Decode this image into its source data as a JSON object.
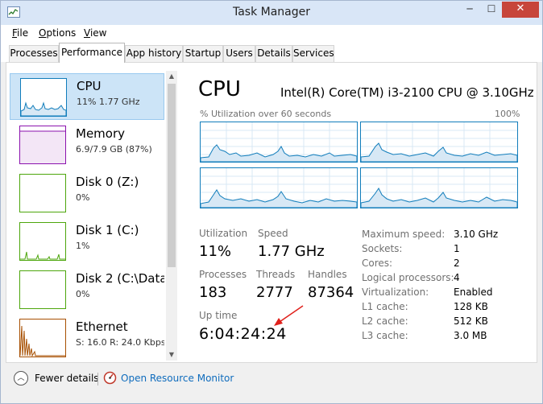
{
  "window": {
    "title": "Task Manager",
    "minimize_glyph": "─",
    "maximize_glyph": "☐",
    "close_glyph": "✕",
    "icon": "task-manager-icon"
  },
  "menu": [
    {
      "label": "File",
      "key": "F"
    },
    {
      "label": "Options",
      "key": "O"
    },
    {
      "label": "View",
      "key": "V"
    }
  ],
  "tabs": [
    {
      "label": "Processes",
      "active": false
    },
    {
      "label": "Performance",
      "active": true
    },
    {
      "label": "App history",
      "active": false
    },
    {
      "label": "Startup",
      "active": false
    },
    {
      "label": "Users",
      "active": false
    },
    {
      "label": "Details",
      "active": false
    },
    {
      "label": "Services",
      "active": false
    }
  ],
  "sidebar": {
    "items": [
      {
        "title": "CPU",
        "subtitle": "11% 1.77 GHz",
        "selected": true,
        "color": "#117dbb"
      },
      {
        "title": "Memory",
        "subtitle": "6.9/7.9 GB (87%)",
        "selected": false,
        "color": "#8b12ae"
      },
      {
        "title": "Disk 0 (Z:)",
        "subtitle": "0%",
        "selected": false,
        "color": "#4da60c"
      },
      {
        "title": "Disk 1 (C:)",
        "subtitle": "1%",
        "selected": false,
        "color": "#4da60c"
      },
      {
        "title": "Disk 2 (C:\\Data\\",
        "subtitle": "0%",
        "selected": false,
        "color": "#4da60c"
      },
      {
        "title": "Ethernet",
        "subtitle": "S: 16.0  R: 24.0 Kbps",
        "selected": false,
        "color": "#a74f01"
      }
    ],
    "scroll_up_glyph": "▲",
    "scroll_down_glyph": "▼"
  },
  "detail": {
    "title": "CPU",
    "model": "Intel(R) Core(TM) i3-2100 CPU @ 3.10GHz",
    "graph_caption": "% Utilization over 60 seconds",
    "graph_max": "100%",
    "graph_color": "#117dbb"
  },
  "stats": {
    "utilization": {
      "label": "Utilization",
      "value": "11%"
    },
    "speed": {
      "label": "Speed",
      "value": "1.77 GHz"
    },
    "processes": {
      "label": "Processes",
      "value": "183"
    },
    "threads": {
      "label": "Threads",
      "value": "2777"
    },
    "handles": {
      "label": "Handles",
      "value": "87364"
    },
    "uptime": {
      "label": "Up time",
      "value": "6:04:24:24"
    }
  },
  "specs": [
    {
      "label": "Maximum speed:",
      "value": "3.10 GHz"
    },
    {
      "label": "Sockets:",
      "value": "1"
    },
    {
      "label": "Cores:",
      "value": "2"
    },
    {
      "label": "Logical processors:",
      "value": "4"
    },
    {
      "label": "Virtualization:",
      "value": "Enabled"
    },
    {
      "label": "L1 cache:",
      "value": "128 KB"
    },
    {
      "label": "L2 cache:",
      "value": "512 KB"
    },
    {
      "label": "L3 cache:",
      "value": "3.0 MB"
    }
  ],
  "footer": {
    "fewer_details": "Fewer details",
    "fewer_glyph": "︿",
    "open_monitor": "Open Resource Monitor",
    "link_color": "#0f6cbd"
  },
  "annotation": {
    "arrow_color": "#e0201b"
  }
}
